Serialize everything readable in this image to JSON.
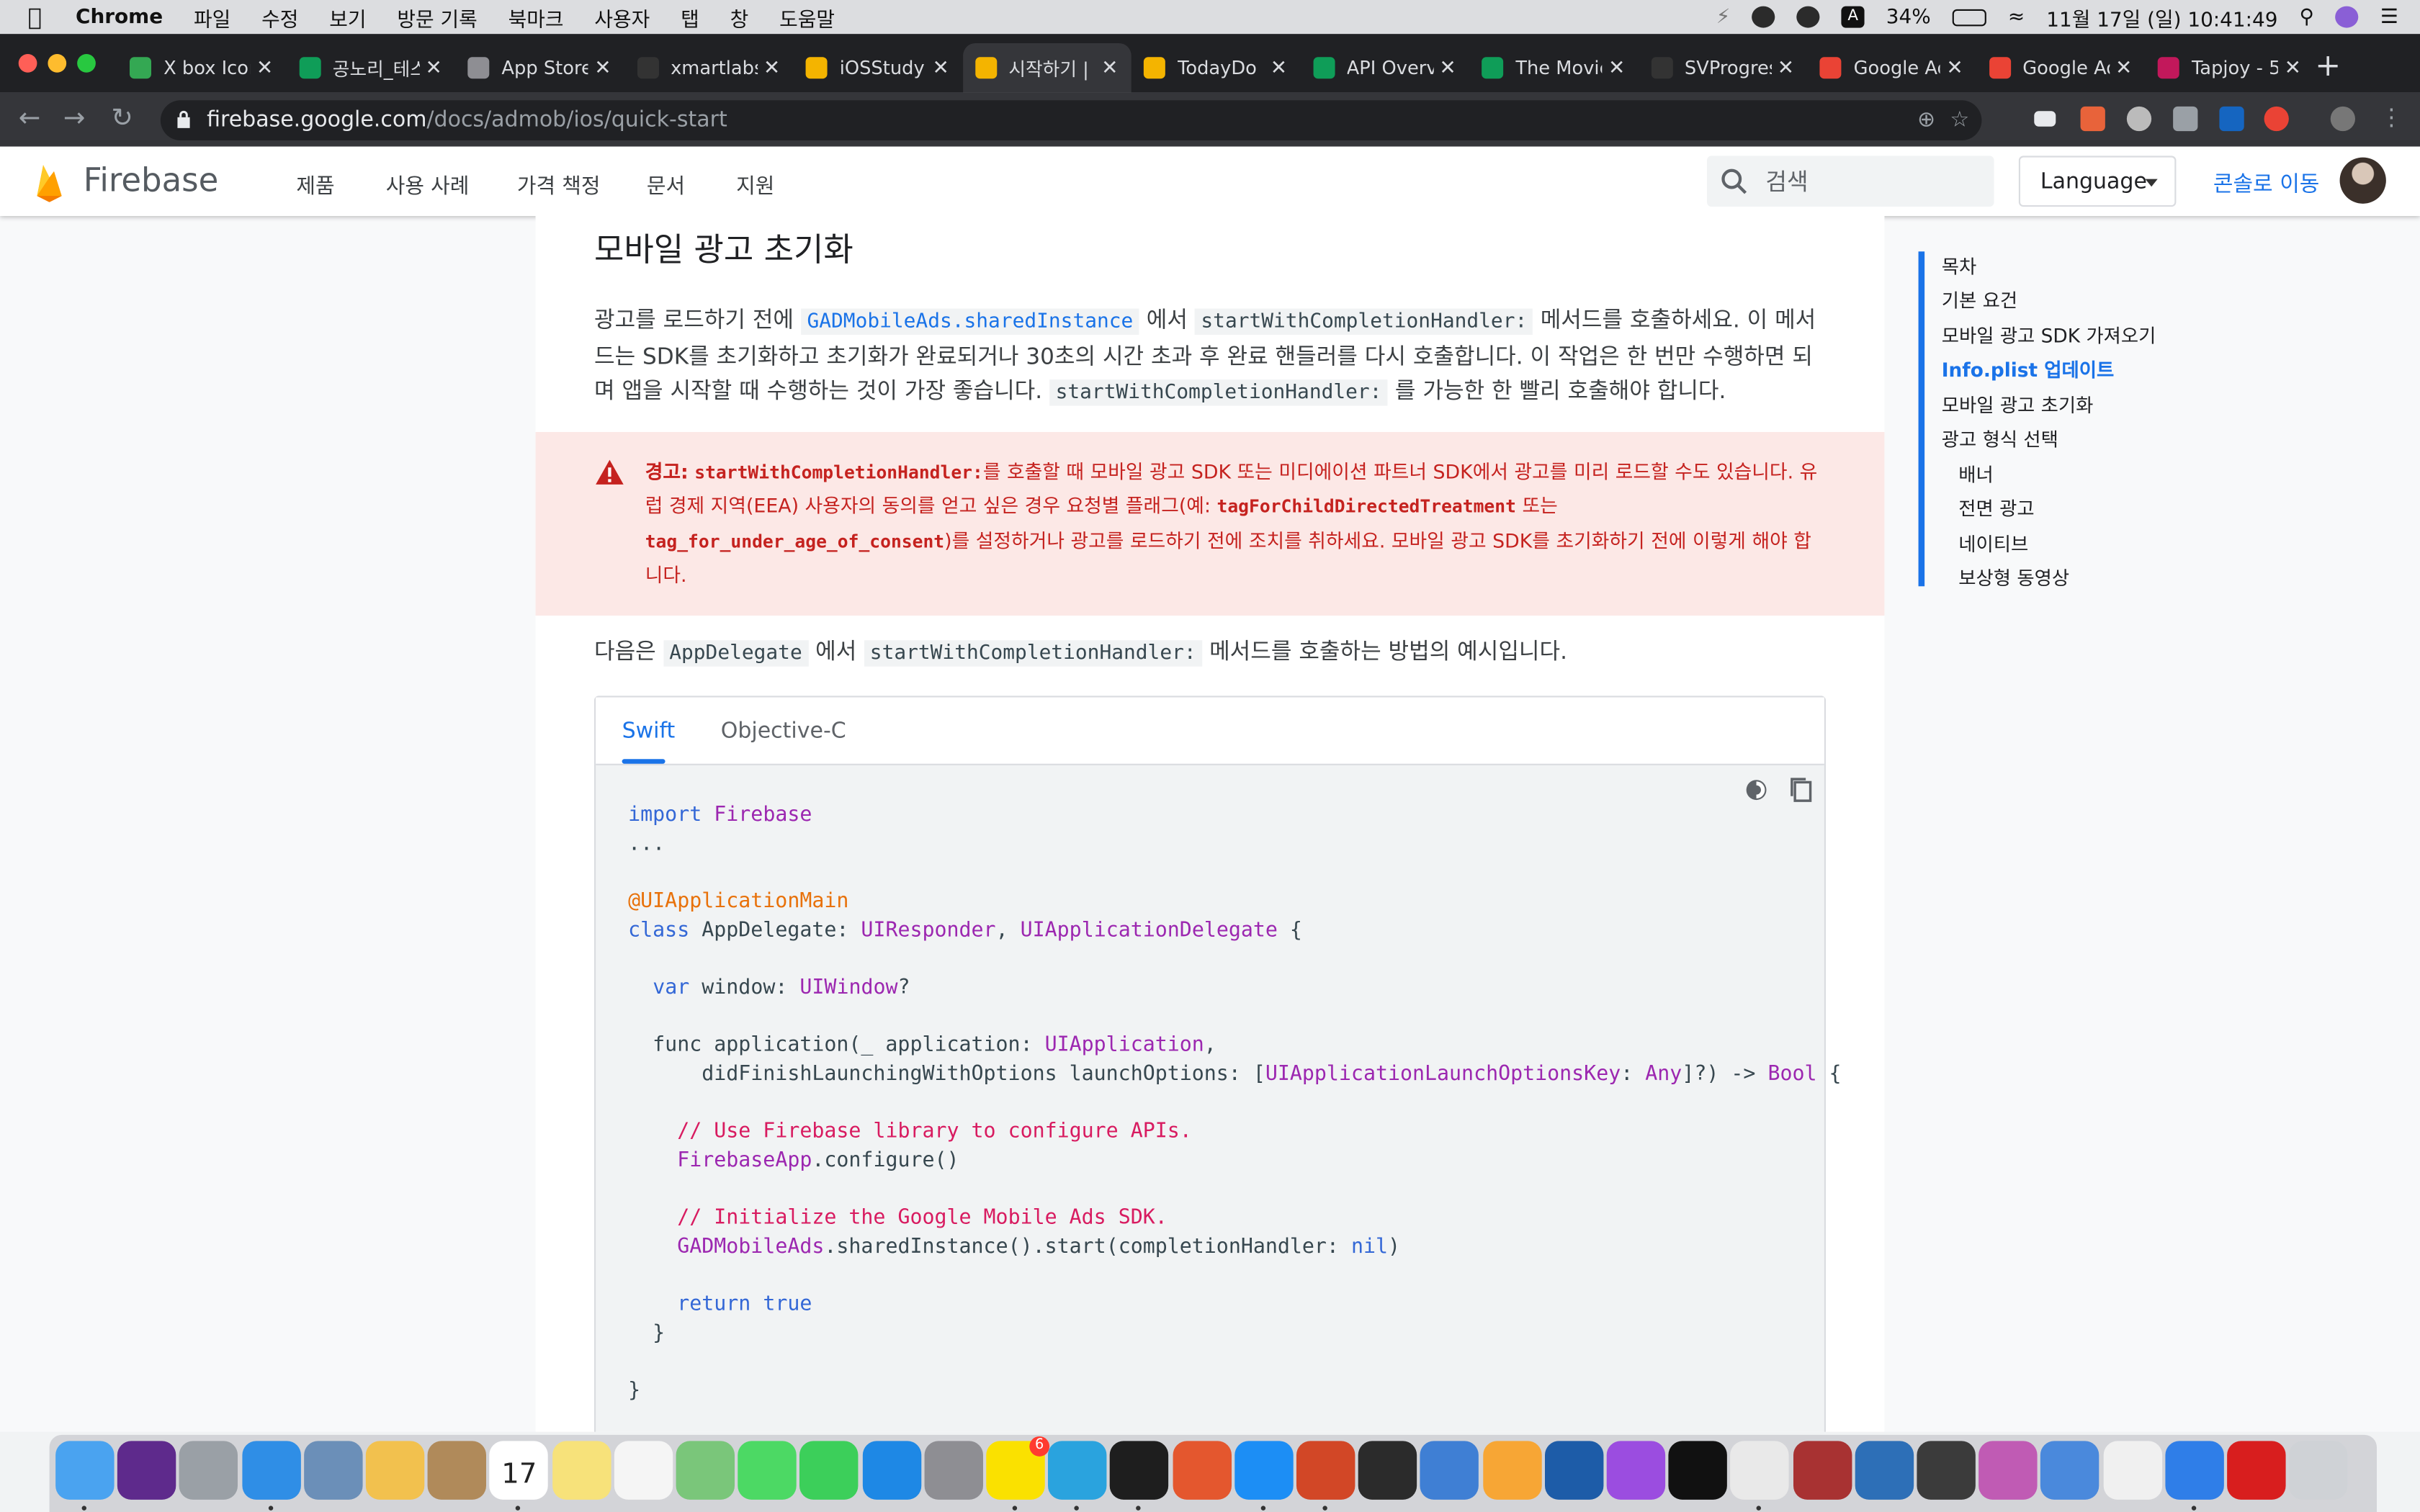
{
  "menubar": {
    "app": "Chrome",
    "items": [
      "파일",
      "수정",
      "보기",
      "방문 기록",
      "북마크",
      "사용자",
      "탭",
      "창",
      "도움말"
    ],
    "battery": "34%",
    "datetime": "11월 17일 (일)  10:41:49"
  },
  "tabs": [
    {
      "title": "X box Icon",
      "color": "#34a853"
    },
    {
      "title": "공노리_테스",
      "color": "#0f9d58"
    },
    {
      "title": "App Store",
      "color": "#8e8e93"
    },
    {
      "title": "xmartlabs",
      "color": "#333333"
    },
    {
      "title": "iOSStudy",
      "color": "#f4b400"
    },
    {
      "title": "시작하기 |",
      "color": "#f4b400"
    },
    {
      "title": "TodayDo",
      "color": "#f4b400"
    },
    {
      "title": "API Overv",
      "color": "#0f9d58"
    },
    {
      "title": "The Movie",
      "color": "#0f9d58"
    },
    {
      "title": "SVProgres",
      "color": "#333333"
    },
    {
      "title": "Google Ad",
      "color": "#ea4335"
    },
    {
      "title": "Google Ad",
      "color": "#ea4335"
    },
    {
      "title": "Tapjoy - 5",
      "color": "#c2185b"
    }
  ],
  "address": {
    "host": "firebase.google.com",
    "path": "/docs/admob/ios/quick-start"
  },
  "header": {
    "brand": "Firebase",
    "nav": [
      "제품",
      "사용 사례",
      "가격 책정",
      "문서",
      "지원"
    ],
    "search_placeholder": "검색",
    "language": "Language",
    "console": "콘솔로 이동"
  },
  "content": {
    "title": "모바일 광고 초기화",
    "para1": {
      "t1": "광고를 로드하기 전에 ",
      "c1": "GADMobileAds.sharedInstance",
      "t2": " 에서 ",
      "c2": "startWithCompletionHandler:",
      "t3": " 메서드를 호출하세요. 이 메서드는 SDK를 초기화하고 초기화가 완료되거나 30초의 시간 초과 후 완료 핸들러를 다시 호출합니다. 이 작업은 한 번만 수행하면 되며 앱을 시작할 때 수행하는 것이 가장 좋습니다. ",
      "c3": "startWithCompletionHandler:",
      "t4": " 를 가능한 한 빨리 호출해야 합니다."
    },
    "warning": {
      "label": "경고:",
      "c1": "startWithCompletionHandler:",
      "t1": "를 호출할 때 모바일 광고 SDK 또는 미디에이션 파트너 SDK에서 광고를 미리 로드할 수도 있습니다. 유럽 경제 지역(EEA) 사용자의 동의를 얻고 싶은 경우 요청별 플래그(예: ",
      "c2": "tagForChildDirectedTreatment",
      "t2": " 또는 ",
      "c3": "tag_for_under_age_of_consent",
      "t3": ")를 설정하거나 광고를 로드하기 전에 조치를 취하세요. 모바일 광고 SDK를 초기화하기 전에 이렇게 해야 합니다."
    },
    "para2": {
      "t1": "다음은 ",
      "c1": "AppDelegate",
      "t2": " 에서 ",
      "c2": "startWithCompletionHandler:",
      "t3": " 메서드를 호출하는 방법의 예시입니다."
    },
    "code_tabs": [
      "Swift",
      "Objective-C"
    ]
  },
  "toc": {
    "items": [
      "목차",
      "기본 요건",
      "모바일 광고 SDK 가져오기",
      "Info.plist 업데이트",
      "모바일 광고 초기화",
      "광고 형식 선택",
      "배너",
      "전면 광고",
      "네이티브",
      "보상형 동영상"
    ]
  },
  "dock": {
    "badges": {
      "calendar": "17",
      "kakaotalk": "6"
    },
    "apps": [
      {
        "name": "finder",
        "color": "#4aa3f0"
      },
      {
        "name": "siri",
        "color": "#5e2a8c"
      },
      {
        "name": "launchpad",
        "color": "#9aa0a6"
      },
      {
        "name": "safari",
        "color": "#2f8ee6"
      },
      {
        "name": "preview",
        "color": "#6b8fb8"
      },
      {
        "name": "photos",
        "color": "#f2c14e"
      },
      {
        "name": "contacts",
        "color": "#b08a5a"
      },
      {
        "name": "calendar",
        "color": "#ffffff"
      },
      {
        "name": "notes",
        "color": "#f7e27a"
      },
      {
        "name": "reminders",
        "color": "#f5f5f5"
      },
      {
        "name": "maps",
        "color": "#7ac67a"
      },
      {
        "name": "messages",
        "color": "#4cd964"
      },
      {
        "name": "facetime",
        "color": "#3ccf5a"
      },
      {
        "name": "app-store",
        "color": "#1e88e5"
      },
      {
        "name": "system-preferences",
        "color": "#8e8e93"
      },
      {
        "name": "kakaotalk",
        "color": "#fae100"
      },
      {
        "name": "telegram",
        "color": "#2aa3de"
      },
      {
        "name": "terminal",
        "color": "#1e1e1e"
      },
      {
        "name": "git-client",
        "color": "#e4572e"
      },
      {
        "name": "xcode",
        "color": "#1c8ef5"
      },
      {
        "name": "powerpoint",
        "color": "#d24726"
      },
      {
        "name": "iterm",
        "color": "#2b2b2b"
      },
      {
        "name": "xcode-instruments",
        "color": "#3f7fd4"
      },
      {
        "name": "sketch",
        "color": "#f7a635"
      },
      {
        "name": "sourcetree",
        "color": "#1d5ca8"
      },
      {
        "name": "podcasts",
        "color": "#9b4de0"
      },
      {
        "name": "apple-tv",
        "color": "#111111"
      },
      {
        "name": "chrome",
        "color": "#e9e9e9"
      },
      {
        "name": "dictionary",
        "color": "#a83232"
      },
      {
        "name": "quicktime",
        "color": "#2d6fb7"
      },
      {
        "name": "instruments",
        "color": "#3b3b3b"
      },
      {
        "name": "macos-installer",
        "color": "#c05bb4"
      },
      {
        "name": "keynote",
        "color": "#4a89dc"
      },
      {
        "name": "textedit",
        "color": "#f0f0f0"
      },
      {
        "name": "folder",
        "color": "#2f7ee8"
      },
      {
        "name": "flash",
        "color": "#d81e1e"
      },
      {
        "name": "trash",
        "color": "#cfd2d6"
      }
    ]
  }
}
